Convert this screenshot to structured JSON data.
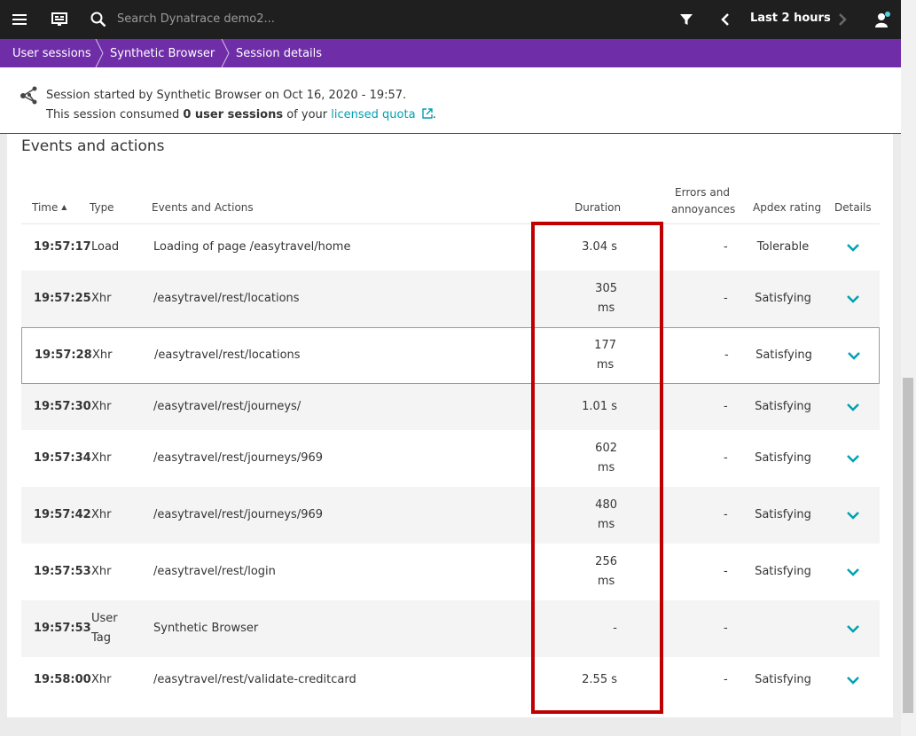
{
  "topbar": {
    "search_placeholder": "Search Dynatrace demo2...",
    "timeframe": "Last 2 hours"
  },
  "breadcrumb": [
    "User sessions",
    "Synthetic Browser",
    "Session details"
  ],
  "session": {
    "line1": "Session started by Synthetic Browser on Oct 16, 2020 - 19:57.",
    "line2_prefix": "This session consumed ",
    "line2_bold": "0 user sessions",
    "line2_mid": " of your ",
    "line2_link": "licensed quota",
    "line2_end": "."
  },
  "section_title": "Events and actions",
  "columns": {
    "time": "Time",
    "type": "Type",
    "events": "Events and Actions",
    "duration": "Duration",
    "errors_1": "Errors and",
    "errors_2": "annoyances",
    "apdex": "Apdex rating",
    "details": "Details"
  },
  "rows": [
    {
      "time": "19:57:17",
      "type": "Load",
      "type2": "",
      "action": "Loading of page /easytravel/home",
      "dur1": "3.04 s",
      "dur2": "",
      "errors": "-",
      "apdex": "Tolerable"
    },
    {
      "time": "19:57:25",
      "type": "Xhr",
      "type2": "",
      "action": "/easytravel/rest/locations",
      "dur1": "305",
      "dur2": "ms",
      "errors": "-",
      "apdex": "Satisfying"
    },
    {
      "time": "19:57:28",
      "type": "Xhr",
      "type2": "",
      "action": "/easytravel/rest/locations",
      "dur1": "177",
      "dur2": "ms",
      "errors": "-",
      "apdex": "Satisfying"
    },
    {
      "time": "19:57:30",
      "type": "Xhr",
      "type2": "",
      "action": "/easytravel/rest/journeys/",
      "dur1": "1.01 s",
      "dur2": "",
      "errors": "-",
      "apdex": "Satisfying"
    },
    {
      "time": "19:57:34",
      "type": "Xhr",
      "type2": "",
      "action": "/easytravel/rest/journeys/969",
      "dur1": "602",
      "dur2": "ms",
      "errors": "-",
      "apdex": "Satisfying"
    },
    {
      "time": "19:57:42",
      "type": "Xhr",
      "type2": "",
      "action": "/easytravel/rest/journeys/969",
      "dur1": "480",
      "dur2": "ms",
      "errors": "-",
      "apdex": "Satisfying"
    },
    {
      "time": "19:57:53",
      "type": "Xhr",
      "type2": "",
      "action": "/easytravel/rest/login",
      "dur1": "256",
      "dur2": "ms",
      "errors": "-",
      "apdex": "Satisfying"
    },
    {
      "time": "19:57:53",
      "type": "User",
      "type2": "Tag",
      "action": "Synthetic Browser",
      "dur1": "-",
      "dur2": "",
      "errors": "-",
      "apdex": ""
    },
    {
      "time": "19:58:00",
      "type": "Xhr",
      "type2": "",
      "action": "/easytravel/rest/validate-creditcard",
      "dur1": "2.55 s",
      "dur2": "",
      "errors": "-",
      "apdex": "Satisfying"
    }
  ],
  "colors": {
    "accent": "#6f2da8",
    "link": "#00a1b2",
    "highlight": "#c00000"
  }
}
